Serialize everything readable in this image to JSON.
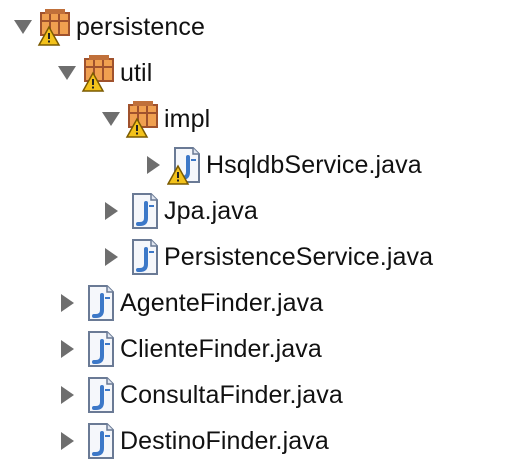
{
  "tree": {
    "nodes": [
      {
        "label": "persistence",
        "type": "package",
        "expanded": true,
        "warning": true
      },
      {
        "label": "util",
        "type": "package",
        "expanded": true,
        "warning": true
      },
      {
        "label": "impl",
        "type": "package",
        "expanded": true,
        "warning": true
      },
      {
        "label": "HsqldbService.java",
        "type": "java-file",
        "expanded": false,
        "warning": true
      },
      {
        "label": "Jpa.java",
        "type": "java-file",
        "expanded": false,
        "warning": false
      },
      {
        "label": "PersistenceService.java",
        "type": "java-file",
        "expanded": false,
        "warning": false
      },
      {
        "label": "AgenteFinder.java",
        "type": "java-file",
        "expanded": false,
        "warning": false
      },
      {
        "label": "ClienteFinder.java",
        "type": "java-file",
        "expanded": false,
        "warning": false
      },
      {
        "label": "ConsultaFinder.java",
        "type": "java-file",
        "expanded": false,
        "warning": false
      },
      {
        "label": "DestinoFinder.java",
        "type": "java-file",
        "expanded": false,
        "warning": false
      }
    ]
  },
  "icons": {
    "expand": "chevron-down-icon",
    "collapse": "chevron-right-icon",
    "package": "package-icon",
    "java_file": "java-file-icon",
    "warning": "warning-icon"
  },
  "colors": {
    "arrow": "#6e6e6e",
    "package_brown": "#b5651d",
    "package_orange": "#f0a050",
    "java_blue": "#3c78c8",
    "file_bg": "#f5f7fb",
    "warning_yellow": "#f3c21b"
  }
}
